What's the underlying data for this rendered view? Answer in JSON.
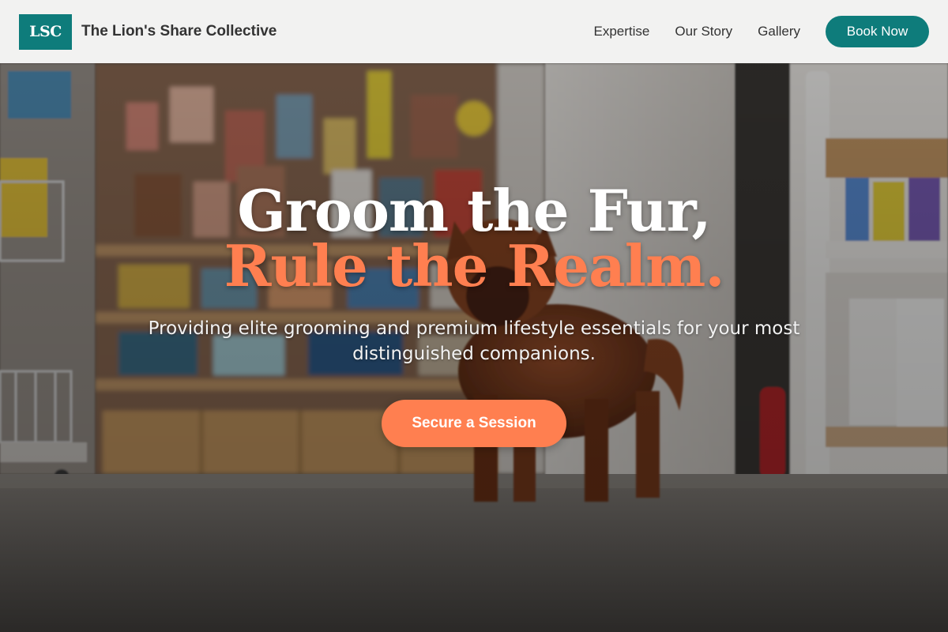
{
  "nav": {
    "logo_text": "LSC",
    "brand_name": "The Lion's Share Collective",
    "links": [
      {
        "label": "Expertise"
      },
      {
        "label": "Our Story"
      },
      {
        "label": "Gallery"
      }
    ],
    "cta_label": "Book Now"
  },
  "hero": {
    "headline_line1": "Groom the Fur,",
    "headline_line2": "Rule the Realm.",
    "subtitle": "Providing elite grooming and premium lifestyle essentials for your most distinguished companions.",
    "cta_label": "Secure a Session",
    "background_image": "dog-in-pet-store-photo"
  },
  "colors": {
    "brand_teal": "#0e7c7b",
    "accent_coral": "#ff7f50",
    "text_dark": "#333333",
    "text_light": "#ffffff"
  }
}
